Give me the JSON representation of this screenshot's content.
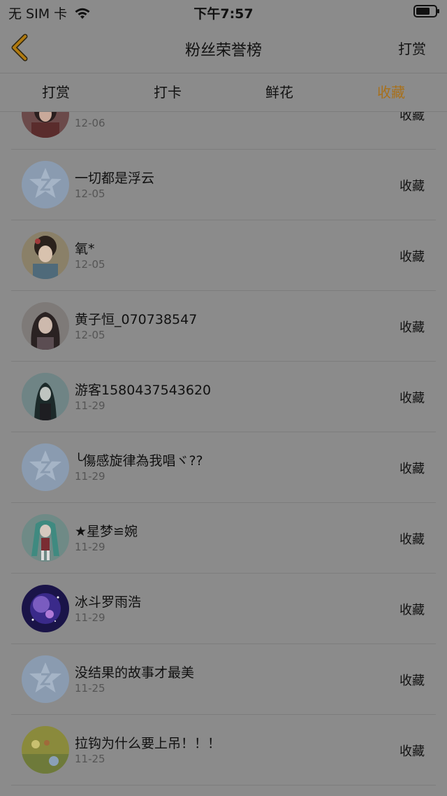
{
  "status_bar": {
    "carrier": "无 SIM 卡",
    "time": "下午7:57"
  },
  "nav": {
    "title": "粉丝荣誉榜",
    "right_label": "打赏"
  },
  "tabs": [
    {
      "label": "打赏",
      "active": false
    },
    {
      "label": "打卡",
      "active": false
    },
    {
      "label": "鲜花",
      "active": false
    },
    {
      "label": "收藏",
      "active": true
    }
  ],
  "colors": {
    "active_tab": "#a8701a",
    "back_arrow": "#b07a10"
  },
  "list": [
    {
      "name": "",
      "date": "12-06",
      "action": "收藏",
      "avatar": "girl-dark-red"
    },
    {
      "name": "一切都是浮云",
      "date": "12-05",
      "action": "收藏",
      "avatar": "default-star"
    },
    {
      "name": "氧*",
      "date": "12-05",
      "action": "收藏",
      "avatar": "girl-traditional"
    },
    {
      "name": "黄子恒_070738547",
      "date": "12-05",
      "action": "收藏",
      "avatar": "girl-long-hair"
    },
    {
      "name": "游客1580437543620",
      "date": "11-29",
      "action": "收藏",
      "avatar": "anime-teal"
    },
    {
      "name": "╰傷感旋律為我唱ヾ??",
      "date": "11-29",
      "action": "收藏",
      "avatar": "default-star"
    },
    {
      "name": "★星梦≌婉",
      "date": "11-29",
      "action": "收藏",
      "avatar": "anime-miku"
    },
    {
      "name": "冰斗罗雨浩",
      "date": "11-29",
      "action": "收藏",
      "avatar": "galaxy"
    },
    {
      "name": "没结果的故事才最美",
      "date": "11-25",
      "action": "收藏",
      "avatar": "default-star"
    },
    {
      "name": "拉钩为什么要上吊！！！",
      "date": "11-25",
      "action": "收藏",
      "avatar": "game-field"
    }
  ]
}
